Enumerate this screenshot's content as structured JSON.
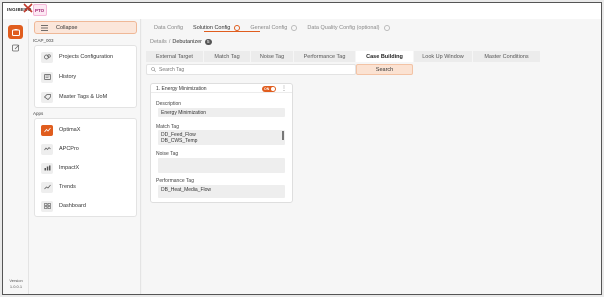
{
  "brand": {
    "logo_text": "INGIBERO",
    "partner_logo": "PTO"
  },
  "rail": {
    "items": [
      {
        "name": "apps-icon",
        "active": true
      },
      {
        "name": "edit-icon",
        "active": false
      }
    ],
    "version_label": "Version",
    "version_value": "1.0.0.1"
  },
  "sidemenu": {
    "collapse_label": "Collapse",
    "project_section": "ICAP_003",
    "project_items": [
      "Projects Configuration",
      "History",
      "Master Tags & UoM"
    ],
    "apps_section": "Apps",
    "app_items": [
      "OptimaX",
      "APCPro",
      "ImpactX",
      "Trends",
      "Dashboard"
    ]
  },
  "steps": [
    {
      "label": "Data Config",
      "state": "done"
    },
    {
      "label": "Solution Config",
      "state": "active"
    },
    {
      "label": "General Config",
      "state": "done"
    },
    {
      "label": "Data Quality Config (optional)",
      "state": "done"
    }
  ],
  "breadcrumb": {
    "parent": "Details",
    "separator": "/",
    "current": "Debutanizer",
    "badge": "5"
  },
  "tabs": [
    "External Target",
    "Match Tag",
    "Noise Tag",
    "Performance Tag",
    "Case Building",
    "Look Up Window",
    "Master Conditions"
  ],
  "active_tab": "Case Building",
  "search": {
    "placeholder": "Search Tag",
    "button_label": "Search"
  },
  "case_card": {
    "title": "1. Energy Minimization",
    "toggle_label": "ON",
    "description_label": "Description",
    "description_value": "Energy Minimization",
    "match_tag_label": "Match Tag",
    "match_tags": [
      "DD_Feed_Flow",
      "DB_CWS_Temp"
    ],
    "noise_tag_label": "Noise Tag",
    "noise_tag_value": "",
    "performance_tag_label": "Performance Tag",
    "performance_tag_value": "DB_Heat_Media_Flow"
  },
  "colors": {
    "accent": "#e05d1e",
    "accent_light": "#fbe2d2"
  }
}
